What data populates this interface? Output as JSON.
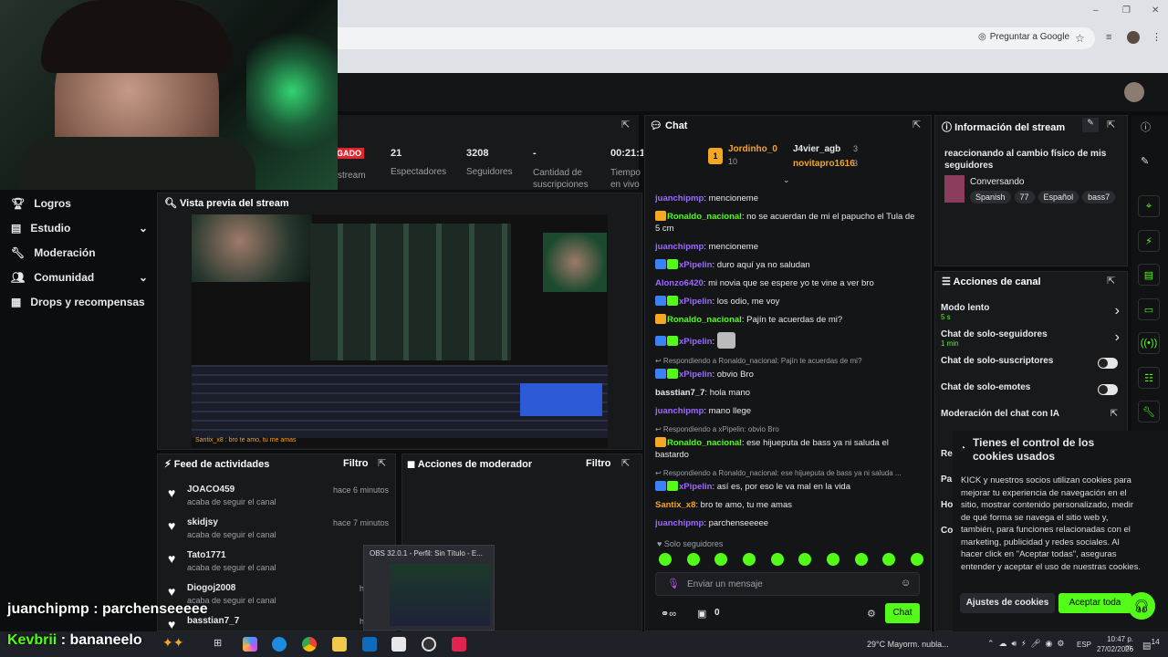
{
  "browser": {
    "ask_google": "Preguntar a Google",
    "win": [
      "–",
      "❐",
      "✕"
    ]
  },
  "stats": [
    {
      "value": "",
      "label": "stream",
      "tag": "GADO"
    },
    {
      "value": "21",
      "label": "Espectadores"
    },
    {
      "value": "3208",
      "label": "Seguidores"
    },
    {
      "value": "-",
      "label": "Cantidad de suscripciones"
    },
    {
      "value": "00:21:1",
      "label": "Tiempo en vivo"
    }
  ],
  "nav": [
    {
      "label": "Logros",
      "icon": "trophy-icon"
    },
    {
      "label": "Estudio",
      "icon": "studio-icon",
      "chevron": true
    },
    {
      "label": "Moderación",
      "icon": "wrench-icon"
    },
    {
      "label": "Comunidad",
      "icon": "community-icon",
      "chevron": true
    },
    {
      "label": "Drops y recompensas",
      "icon": "gift-icon"
    }
  ],
  "preview": {
    "title": "Vista previa del stream",
    "overlay": "Santix_x8 : bro te amo, tu me amas"
  },
  "feed": {
    "title": "Feed de actividades",
    "filter": "Filtro",
    "items": [
      {
        "user": "JOACO459",
        "action": "acaba de seguir el canal",
        "time": "hace 6 minutos"
      },
      {
        "user": "skidjsy",
        "action": "acaba de seguir el canal",
        "time": "hace 7 minutos"
      },
      {
        "user": "Tato1771",
        "action": "acaba de seguir el canal",
        "time": "hace 8"
      },
      {
        "user": "Diogoj2008",
        "action": "acaba de seguir el canal",
        "time": "hace 23"
      },
      {
        "user": "basstian7_7",
        "action": "",
        "time": "hace 33"
      }
    ]
  },
  "modactions": {
    "title": "Acciones de moderador",
    "filter": "Filtro"
  },
  "obs_popup": {
    "title": "OBS 32.0.1 - Perfil: Sin Título - E..."
  },
  "chat": {
    "title": "Chat",
    "leaders": [
      {
        "name": "Jordinho_0",
        "count": "10"
      },
      {
        "name": "J4vier_agb",
        "count": "3"
      },
      {
        "name": "novitapro1616",
        "count": "3"
      }
    ],
    "messages": [
      {
        "user": "juanchipmp",
        "color": "#9b6bff",
        "text": "mencioneme"
      },
      {
        "user": "Ronaldo_nacional",
        "color": "#53fc18",
        "text": "no se acuerdan de mi el papucho el Tula de 5 cm",
        "crown": true
      },
      {
        "user": "juanchipmp",
        "color": "#9b6bff",
        "text": "mencioneme"
      },
      {
        "user": "xPipelin",
        "color": "#9b6bff",
        "text": "duro aquí ya no saludan",
        "badges": true
      },
      {
        "user": "Alonzo6420",
        "color": "#9b6bff",
        "text": "mi novia que se espere yo te vine a ver bro"
      },
      {
        "user": "xPipelin",
        "color": "#9b6bff",
        "text": "los odio, me voy",
        "badges": true
      },
      {
        "user": "Ronaldo_nacional",
        "color": "#53fc18",
        "text": "Pajín te acuerdas de mi?",
        "crown": true
      },
      {
        "user": "xPipelin",
        "color": "#9b6bff",
        "text": "",
        "badges": true,
        "emote": true
      },
      {
        "reply": "Respondiendo a Ronaldo_nacional: Pajín te acuerdas de mi?"
      },
      {
        "user": "xPipelin",
        "color": "#9b6bff",
        "text": "obvio Bro",
        "badges": true
      },
      {
        "user": "basstian7_7",
        "color": "#e8e8e8",
        "text": "hola mano"
      },
      {
        "user": "juanchipmp",
        "color": "#9b6bff",
        "text": "mano llege"
      },
      {
        "reply": "Respondiendo a xPipelin: obvio Bro"
      },
      {
        "user": "Ronaldo_nacional",
        "color": "#53fc18",
        "text": "ese hijueputa de bass ya ni saluda el bastardo",
        "crown": true
      },
      {
        "reply": "Respondiendo a Ronaldo_nacional: ese hijueputa de bass ya ni saluda ..."
      },
      {
        "user": "xPipelin",
        "color": "#9b6bff",
        "text": "así es, por eso le va mal en la vida",
        "badges": true
      },
      {
        "user": "Santix_x8",
        "color": "#f5a623",
        "text": "bro te amo, tu me amas"
      },
      {
        "user": "juanchipmp",
        "color": "#9b6bff",
        "text": "parchenseeeee"
      },
      {
        "user": "Kevbrii",
        "color": "#53fc18",
        "text": "bananeelo"
      }
    ],
    "mode": "Solo seguidores",
    "placeholder": "Enviar un mensaje",
    "points": "0",
    "send": "Chat"
  },
  "info": {
    "title": "Información del stream",
    "stream_title": "reaccionando al cambio físico de mis seguidores",
    "category": "Conversando",
    "tags": [
      "Spanish",
      "77",
      "Español",
      "bass7"
    ]
  },
  "actions": {
    "title": "Acciones de canal",
    "rows": [
      {
        "label": "Modo lento",
        "sub": "5 s",
        "type": "arrow"
      },
      {
        "label": "Chat de solo-seguidores",
        "sub": "1 min",
        "type": "arrow"
      },
      {
        "label": "Chat de solo-suscriptores",
        "sub": "",
        "type": "toggle"
      },
      {
        "label": "Chat de solo-emotes",
        "sub": "",
        "type": "toggle"
      },
      {
        "label": "Moderación del chat con IA",
        "sub": "",
        "type": "link"
      }
    ],
    "cut": [
      "Re",
      "Pa",
      "Ho",
      "Co"
    ]
  },
  "cookies": {
    "title": "Tienes el control de los cookies usados",
    "body": "KICK y nuestros socios utilizan cookies para mejorar tu experiencia de navegación en el sitio, mostrar contenido personalizado, medir de qué forma se navega el sitio web y, también, para funciones relacionadas con el marketing, publicidad y redes sociales. Al hacer click en \"Aceptar todas\", aseguras entender y aceptar el uso de nuestras cookies.",
    "settings": "Ajustes de cookies",
    "accept": "Aceptar toda"
  },
  "overlay_chat": [
    {
      "user": "juanchipmp",
      "text": "parchenseeeee"
    },
    {
      "user": "Kevbrii",
      "text": "bananeelo"
    }
  ],
  "taskbar": {
    "weather": "29°C  Mayorm. nubla...",
    "lang": "ESP",
    "time": "10:47 p. m.",
    "date": "27/02/2026",
    "notif": "14"
  },
  "colors": {
    "accent": "#53fc18",
    "purple": "#9b6bff",
    "gold": "#f5a623"
  }
}
